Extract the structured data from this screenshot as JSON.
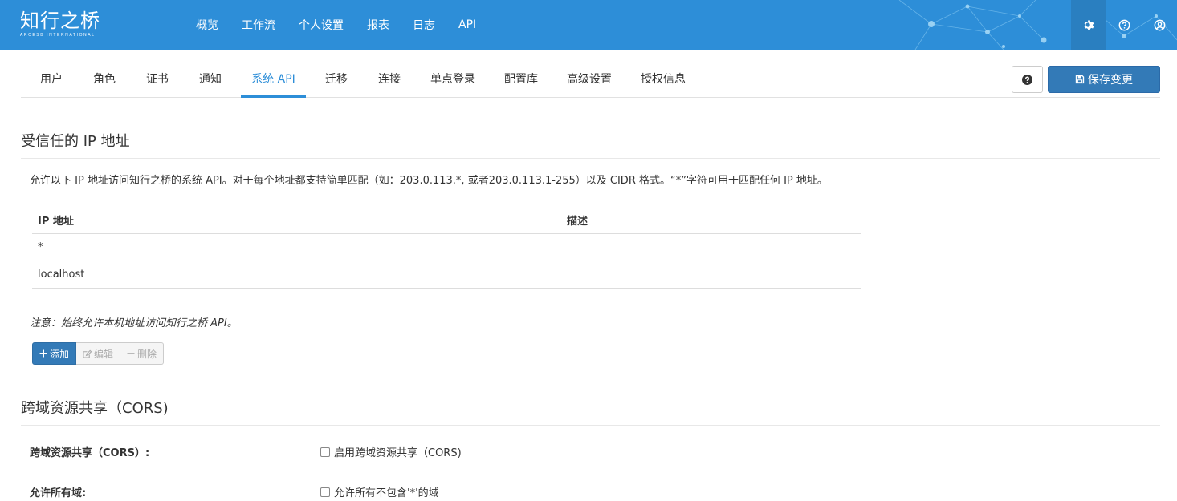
{
  "brand": {
    "name": "知行之桥",
    "subtitle": "ARCESB INTERNATIONAL"
  },
  "main_nav": [
    "概览",
    "工作流",
    "个人设置",
    "报表",
    "日志",
    "API"
  ],
  "top_icons": [
    "gear-icon",
    "help-icon",
    "user-icon"
  ],
  "sub_tabs": [
    "用户",
    "角色",
    "证书",
    "通知",
    "系统 API",
    "迁移",
    "连接",
    "单点登录",
    "配置库",
    "高级设置",
    "授权信息"
  ],
  "active_tab": "系统 API",
  "toolbar": {
    "save_label": "保存变更"
  },
  "trusted_ip": {
    "title": "受信任的 IP 地址",
    "description": "允许以下 IP 地址访问知行之桥的系统 API。对于每个地址都支持简单匹配（如：203.0.113.*, 或者203.0.113.1-255）以及 CIDR 格式。“*”字符可用于匹配任何 IP 地址。",
    "columns": [
      "IP 地址",
      "描述"
    ],
    "rows": [
      {
        "ip": "*",
        "desc": ""
      },
      {
        "ip": "localhost",
        "desc": ""
      }
    ],
    "note": "注意：始终允许本机地址访问知行之桥 API。",
    "buttons": {
      "add": "添加",
      "edit": "编辑",
      "delete": "删除"
    }
  },
  "cors": {
    "title": "跨域资源共享（CORS)",
    "fields": [
      {
        "label": "跨域资源共享（CORS）:",
        "checkbox": "启用跨域资源共享（CORS)",
        "checked": false
      },
      {
        "label": "允许所有域:",
        "checkbox": "允许所有不包含'*'的域",
        "checked": false
      }
    ]
  },
  "colors": {
    "header": "#2d8ed8",
    "primary": "#337ab7",
    "active_tab": "#2d8ed8"
  }
}
